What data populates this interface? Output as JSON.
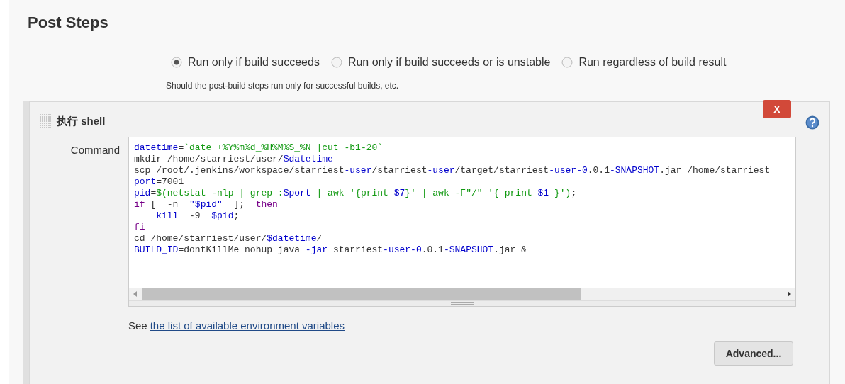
{
  "section_title": "Post Steps",
  "run_options": [
    {
      "label": "Run only if build succeeds",
      "selected": true
    },
    {
      "label": "Run only if build succeeds or is unstable",
      "selected": false
    },
    {
      "label": "Run regardless of build result",
      "selected": false
    }
  ],
  "run_options_help": "Should the post-build steps run only for successful builds, etc.",
  "build_step": {
    "title": "执行 shell",
    "delete_label": "X",
    "field_label": "Command",
    "command_lines": [
      [
        {
          "kind": "var",
          "text": "datetime"
        },
        {
          "kind": "plain",
          "text": "="
        },
        {
          "kind": "string",
          "text": "`date +%Y%m%d_%H%M%S_%N |cut -b1-20`"
        }
      ],
      [
        {
          "kind": "plain",
          "text": "mkdir /home/starriest/user/"
        },
        {
          "kind": "var",
          "text": "$datetime"
        }
      ],
      [
        {
          "kind": "plain",
          "text": "scp /root/.jenkins/workspace/starriest"
        },
        {
          "kind": "var",
          "text": "-user"
        },
        {
          "kind": "plain",
          "text": "/starriest"
        },
        {
          "kind": "var",
          "text": "-user"
        },
        {
          "kind": "plain",
          "text": "/target/starriest"
        },
        {
          "kind": "var",
          "text": "-user-0"
        },
        {
          "kind": "plain",
          "text": ".0.1"
        },
        {
          "kind": "var",
          "text": "-SNAPSHOT"
        },
        {
          "kind": "plain",
          "text": ".jar /home/starriest"
        }
      ],
      [
        {
          "kind": "var",
          "text": "port"
        },
        {
          "kind": "plain",
          "text": "=7001"
        }
      ],
      [
        {
          "kind": "var",
          "text": "pid"
        },
        {
          "kind": "plain",
          "text": "="
        },
        {
          "kind": "string",
          "text": "$(netstat -nlp | grep :"
        },
        {
          "kind": "var",
          "text": "$port"
        },
        {
          "kind": "string",
          "text": " | awk '{print "
        },
        {
          "kind": "var",
          "text": "$7"
        },
        {
          "kind": "string",
          "text": "}' | awk -F\"/\" '{ print "
        },
        {
          "kind": "var",
          "text": "$1"
        },
        {
          "kind": "string",
          "text": " }')"
        },
        {
          "kind": "plain",
          "text": ";"
        }
      ],
      [
        {
          "kind": "keyword",
          "text": "if"
        },
        {
          "kind": "plain",
          "text": " [  -n  "
        },
        {
          "kind": "var",
          "text": "\"$pid\""
        },
        {
          "kind": "plain",
          "text": "  ];  "
        },
        {
          "kind": "keyword",
          "text": "then"
        }
      ],
      [
        {
          "kind": "var",
          "text": "kill"
        },
        {
          "kind": "plain",
          "text": "  -9  "
        },
        {
          "kind": "var",
          "text": "$pid"
        },
        {
          "kind": "plain",
          "text": ";"
        }
      ],
      [
        {
          "kind": "keyword",
          "text": "fi"
        }
      ],
      [
        {
          "kind": "plain",
          "text": "cd /home/starriest/user/"
        },
        {
          "kind": "var",
          "text": "$datetime"
        },
        {
          "kind": "plain",
          "text": "/"
        }
      ],
      [
        {
          "kind": "var",
          "text": "BUILD_ID"
        },
        {
          "kind": "plain",
          "text": "=dontKillMe nohup java "
        },
        {
          "kind": "var",
          "text": "-jar"
        },
        {
          "kind": "plain",
          "text": " starriest"
        },
        {
          "kind": "var",
          "text": "-user-0"
        },
        {
          "kind": "plain",
          "text": ".0.1"
        },
        {
          "kind": "var",
          "text": "-SNAPSHOT"
        },
        {
          "kind": "plain",
          "text": ".jar &"
        }
      ]
    ],
    "see_prefix": "See",
    "see_link": "the list of available environment variables",
    "advanced_button": "Advanced..."
  }
}
